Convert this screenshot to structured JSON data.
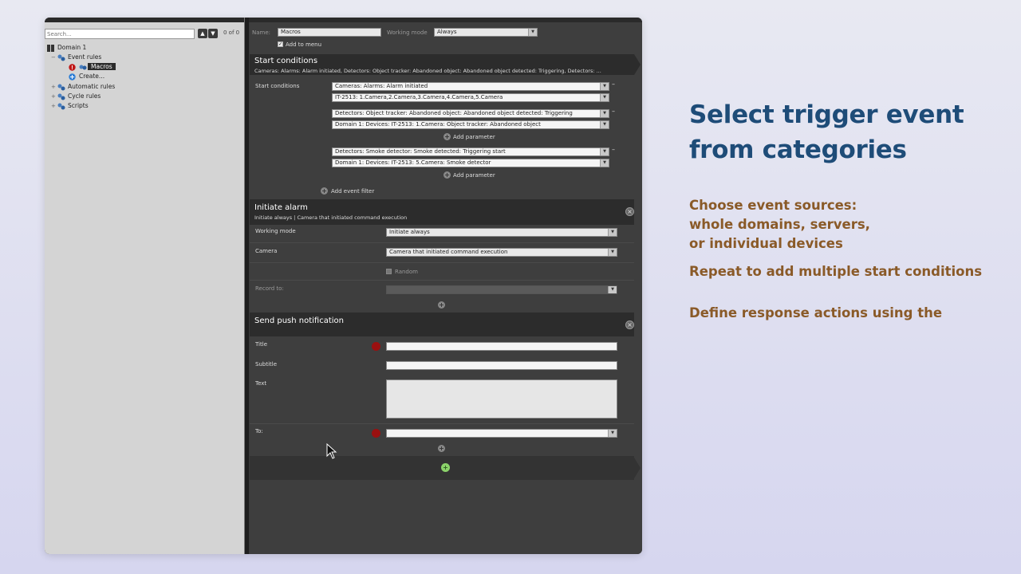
{
  "left_panel": {
    "search_placeholder": "Search...",
    "counter": "0 of 0",
    "tree": {
      "domain": "Domain 1",
      "event_rules": "Event rules",
      "macros": "Macros",
      "create": "Create...",
      "automatic_rules": "Automatic rules",
      "cycle_rules": "Cycle rules",
      "scripts": "Scripts"
    }
  },
  "header": {
    "name_label": "Name:",
    "name_value": "Macros",
    "working_mode_label": "Working mode",
    "working_mode_value": "Always",
    "add_to_menu_label": "Add to menu"
  },
  "start_conditions": {
    "title": "Start conditions",
    "summary": "Cameras: Alarms: Alarm initiated, Detectors: Object tracker: Abandoned object: Abandoned object detected: Triggering, Detectors: ...",
    "row_label": "Start conditions",
    "group1": [
      "Cameras: Alarms: Alarm initiated",
      "IT-2513: 1.Camera,2.Camera,3.Camera,4.Camera,5.Camera"
    ],
    "group2": [
      "Detectors: Object tracker: Abandoned object: Abandoned object detected: Triggering",
      "Domain 1: Devices: IT-2513: 1.Camera: Object tracker: Abandoned object"
    ],
    "group3": [
      "Detectors: Smoke detector: Smoke detected: Triggering start",
      "Domain 1: Devices: IT-2513: 5.Camera: Smoke detector"
    ],
    "add_parameter": "Add parameter",
    "add_event_filter": "Add event filter"
  },
  "initiate_alarm": {
    "title": "Initiate alarm",
    "summary": "Initiate always | Camera that initiated command execution",
    "working_mode_label": "Working mode",
    "working_mode_value": "Initiate always",
    "camera_label": "Camera",
    "camera_value": "Camera that initiated command execution",
    "random_label": "Random",
    "record_to_label": "Record to:"
  },
  "push_notification": {
    "title": "Send push notification",
    "title_label": "Title",
    "subtitle_label": "Subtitle",
    "text_label": "Text",
    "to_label": "To:"
  },
  "overlay": {
    "heading_line1": "Select trigger event",
    "heading_line2": "from categories",
    "para1_line1": "Choose event sources:",
    "para1_line2": "whole domains, servers,",
    "para1_line3": "or individual devices",
    "para2": "Repeat to add multiple start conditions",
    "para3": "Define response actions using the"
  },
  "colors": {
    "heading": "#1e4c78",
    "para": "#8a5a28",
    "required": "#9a1010",
    "add_green": "#8bd26a"
  }
}
